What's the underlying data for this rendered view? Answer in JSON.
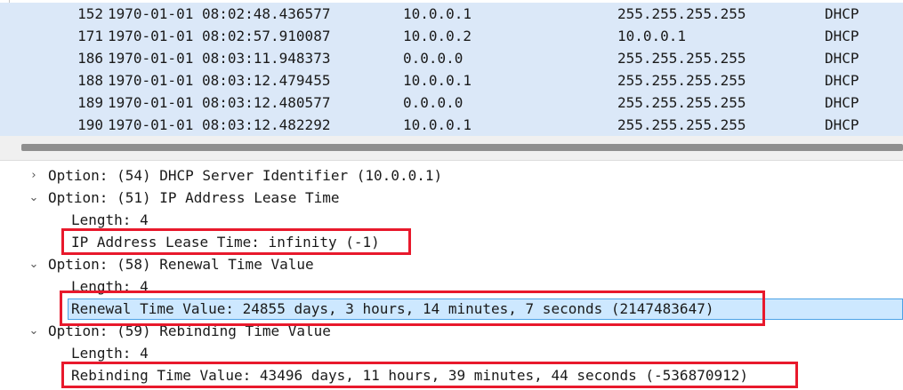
{
  "packet_list": {
    "rows": [
      {
        "no": "152",
        "time": "1970-01-01 08:02:48.436577",
        "source": "10.0.0.1",
        "destination": "255.255.255.255",
        "protocol": "DHCP"
      },
      {
        "no": "171",
        "time": "1970-01-01 08:02:57.910087",
        "source": "10.0.0.2",
        "destination": "10.0.0.1",
        "protocol": "DHCP"
      },
      {
        "no": "186",
        "time": "1970-01-01 08:03:11.948373",
        "source": "0.0.0.0",
        "destination": "255.255.255.255",
        "protocol": "DHCP"
      },
      {
        "no": "188",
        "time": "1970-01-01 08:03:12.479455",
        "source": "10.0.0.1",
        "destination": "255.255.255.255",
        "protocol": "DHCP"
      },
      {
        "no": "189",
        "time": "1970-01-01 08:03:12.480577",
        "source": "0.0.0.0",
        "destination": "255.255.255.255",
        "protocol": "DHCP"
      },
      {
        "no": "190",
        "time": "1970-01-01 08:03:12.482292",
        "source": "10.0.0.1",
        "destination": "255.255.255.255",
        "protocol": "DHCP"
      }
    ]
  },
  "details": {
    "opt54": {
      "label": "Option: (54) DHCP Server Identifier (10.0.0.1)",
      "expander": "›"
    },
    "opt51": {
      "label": "Option: (51) IP Address Lease Time",
      "expander": "⌄",
      "length": "Length: 4",
      "value": "IP Address Lease Time: infinity (-1)"
    },
    "opt58": {
      "label": "Option: (58) Renewal Time Value",
      "expander": "⌄",
      "length": "Length: 4",
      "value": "Renewal Time Value: 24855 days, 3 hours, 14 minutes, 7 seconds (2147483647)"
    },
    "opt59": {
      "label": "Option: (59) Rebinding Time Value",
      "expander": "⌄",
      "length": "Length: 4",
      "value": "Rebinding Time Value: 43496 days, 11 hours, 39 minutes, 44 seconds (-536870912)"
    }
  },
  "colors": {
    "row_highlight": "#dbe8f8",
    "annotation_red": "#e8192c",
    "selected_field": "#cde8ff"
  }
}
